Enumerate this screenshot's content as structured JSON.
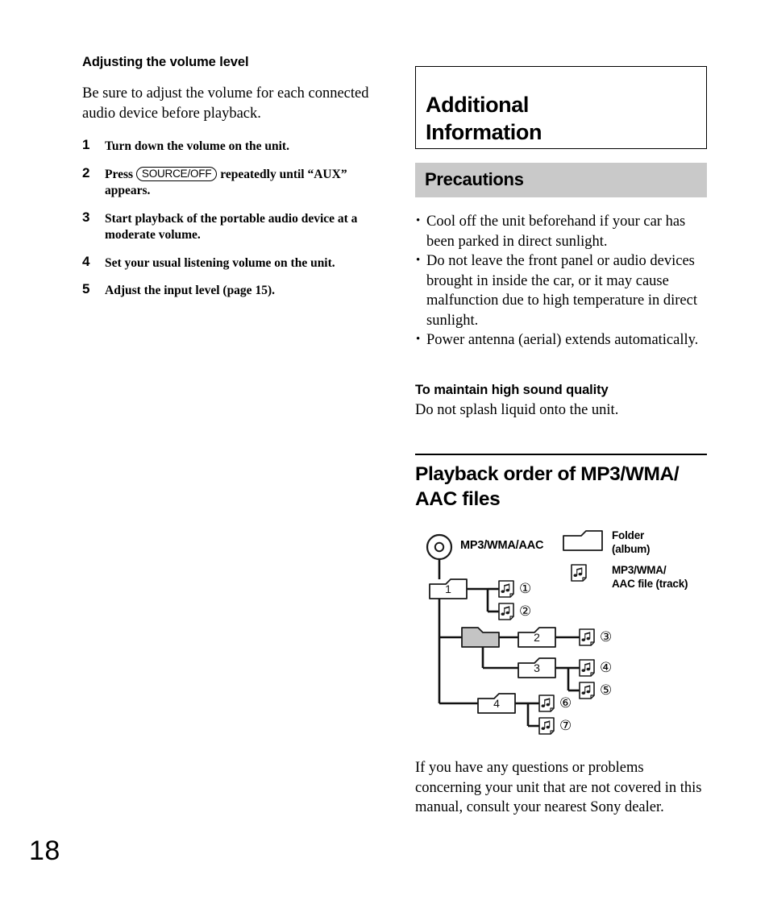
{
  "page": {
    "folio": "18"
  },
  "left_column": {
    "heading": "Adjusting the volume level",
    "intro": "Be sure to adjust the volume for each connected audio device before playback.",
    "steps": [
      {
        "number": "1",
        "text_before": "Turn down the volume on the unit.",
        "button": "",
        "text_after": ""
      },
      {
        "number": "2",
        "text_before": "Press ",
        "button": "SOURCE/OFF",
        "text_after": " repeatedly until “AUX” appears."
      },
      {
        "number": "3",
        "text_before": "Start playback of the portable audio device at a moderate volume.",
        "button": "",
        "text_after": ""
      },
      {
        "number": "4",
        "text_before": "Set your usual listening volume on the unit.",
        "button": "",
        "text_after": ""
      },
      {
        "number": "5",
        "text_before": "Adjust the input level (page 15).",
        "button": "",
        "text_after": ""
      }
    ]
  },
  "right_column": {
    "chapter_title": "Additional\nInformation",
    "precautions": {
      "title": "Precautions",
      "band_color": "#c9c9c9",
      "bullets": [
        "Cool off the unit beforehand if your car has been parked in direct sunlight.",
        "Do not leave the front panel or audio devices brought in inside the car, or it may cause malfunction due to high temperature in direct sunlight.",
        "Power antenna (aerial) extends automatically."
      ]
    },
    "sound_quality": {
      "heading": "To maintain high sound quality",
      "text": "Do not splash liquid onto the unit."
    },
    "playback_order": {
      "title": "Playback order of MP3/WMA/\nAAC files",
      "diagram": {
        "disc_label": "MP3/WMA/AAC",
        "legend": [
          {
            "icon": "folder-icon",
            "label": "Folder\n(album)"
          },
          {
            "icon": "music-file-icon",
            "label": "MP3/WMA/\nAAC file (track)"
          }
        ],
        "root": "disc",
        "folders": [
          {
            "id": "folder-1",
            "label": "1",
            "shaded": false
          },
          {
            "id": "folder-shaded",
            "label": "",
            "shaded": true
          },
          {
            "id": "folder-2",
            "label": "2",
            "shaded": false
          },
          {
            "id": "folder-3",
            "label": "3",
            "shaded": false
          },
          {
            "id": "folder-4",
            "label": "4",
            "shaded": false
          }
        ],
        "tracks": [
          {
            "id": "track-1",
            "label": "①",
            "parent": "folder-1"
          },
          {
            "id": "track-2",
            "label": "②",
            "parent": "folder-1"
          },
          {
            "id": "track-3",
            "label": "③",
            "parent": "folder-2"
          },
          {
            "id": "track-4",
            "label": "④",
            "parent": "folder-3"
          },
          {
            "id": "track-5",
            "label": "⑤",
            "parent": "folder-3"
          },
          {
            "id": "track-6",
            "label": "⑥",
            "parent": "folder-4"
          },
          {
            "id": "track-7",
            "label": "⑦",
            "parent": "folder-4"
          }
        ]
      }
    },
    "closing_text": "If you have any questions or problems concerning your unit that are not covered in this manual, consult your nearest Sony dealer."
  }
}
